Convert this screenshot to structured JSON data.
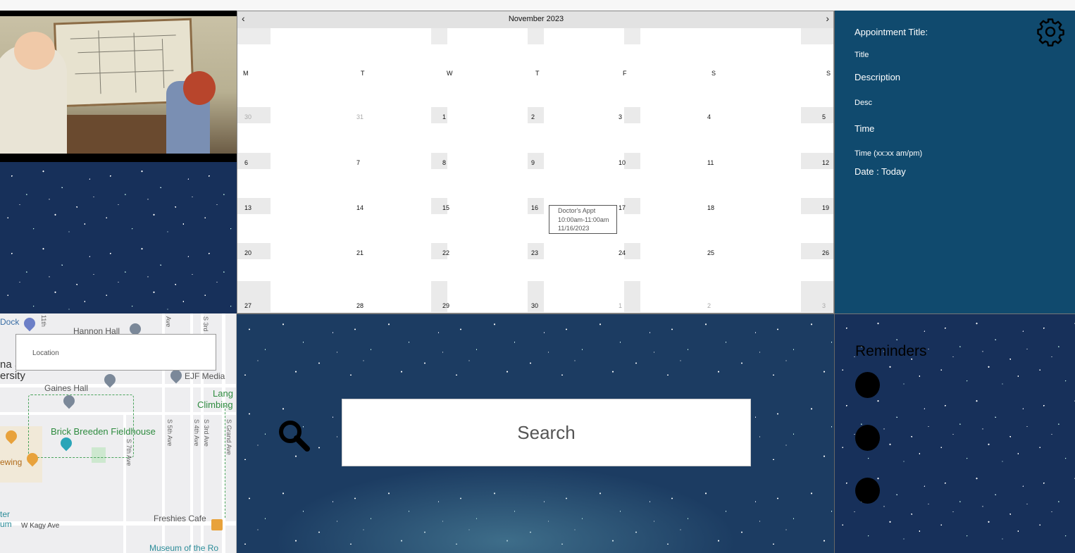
{
  "calendar": {
    "title": "November 2023",
    "prev_label": "‹",
    "next_label": "›",
    "weekdays": [
      "M",
      "T",
      "W",
      "T",
      "F",
      "S",
      "S"
    ],
    "weeks": [
      [
        "30",
        "31",
        "1",
        "2",
        "3",
        "4",
        "5"
      ],
      [
        "6",
        "7",
        "8",
        "9",
        "10",
        "11",
        "12"
      ],
      [
        "13",
        "14",
        "15",
        "16",
        "17",
        "18",
        "19"
      ],
      [
        "20",
        "21",
        "22",
        "23",
        "24",
        "25",
        "26"
      ],
      [
        "27",
        "28",
        "29",
        "30",
        "1",
        "2",
        "3"
      ]
    ],
    "event": {
      "title": "Doctor's Appt",
      "time": "10:00am-11:00am",
      "date": "11/16/2023"
    }
  },
  "appointment": {
    "title_label": "Appointment Title:",
    "title_value": "Title",
    "description_label": "Description",
    "description_value": "Desc",
    "time_label": "Time",
    "time_value": "Time (xx:xx am/pm)",
    "date_label": "Date : Today",
    "settings_icon": "gear-icon"
  },
  "map": {
    "location_placeholder": "Location",
    "labels": {
      "dock": "Dock",
      "hannon_hall": "Hannon Hall",
      "university": "ersity",
      "ana": "na S",
      "gaines_hall": "Gaines Hall",
      "ejf_media": "EJF Media",
      "lang": "Lang",
      "climbing": "Climbing",
      "brick_breeden": "Brick Breeden Fieldhouse",
      "ewing": "ewing",
      "ter": "ter",
      "um": "um",
      "w_kagy_ave": "W Kagy Ave",
      "freshies_cafe": "Freshies Cafe",
      "museum": "Museum of the Ro",
      "s_7th_ave": "S 7th Ave",
      "s_5th_ave": "S 5th Ave",
      "s_4th_ave": "S 4th Ave",
      "s_3rd_ave": "S 3rd Ave",
      "s_grand_ave": "S Grand Ave",
      "11th": "11th",
      "ave": "Ave",
      "s3rd": "S 3rd"
    }
  },
  "search": {
    "placeholder": "Search",
    "icon": "search-icon"
  },
  "reminders": {
    "title": "Reminders",
    "count": 3
  },
  "colors": {
    "panel_blue": "#104a6e",
    "calendar_header": "#e2e2e2"
  }
}
